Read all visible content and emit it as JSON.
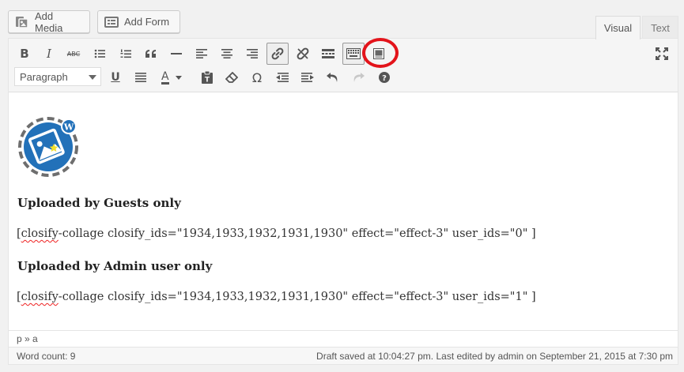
{
  "buttons": {
    "add_media": "Add Media",
    "add_form": "Add Form"
  },
  "tabs": {
    "visual": "Visual",
    "text": "Text"
  },
  "toolbar": {
    "format_select": "Paragraph",
    "row1_icons": [
      "bold-icon",
      "italic-icon",
      "strikethrough-icon",
      "bulleted-list-icon",
      "numbered-list-icon",
      "blockquote-icon",
      "horizontal-line-icon",
      "align-left-icon",
      "align-center-icon",
      "align-right-icon",
      "link-icon",
      "unlink-icon",
      "read-more-icon",
      "toolbar-toggle-icon",
      "collage-shortcode-icon",
      "fullscreen-icon"
    ],
    "row2_icons": [
      "underline-icon",
      "justify-icon",
      "text-color-icon",
      "paste-text-icon",
      "clear-formatting-icon",
      "special-character-icon",
      "outdent-icon",
      "indent-icon",
      "undo-icon",
      "redo-icon",
      "help-icon"
    ],
    "bold_label": "B",
    "italic_label": "I",
    "strike_label": "ABC",
    "underline_label": "U",
    "omega_label": "Ω",
    "color_label": "A",
    "highlight_color": "#e3141b"
  },
  "content": {
    "heading1": "Uploaded by Guests only",
    "shortcode1_prefix": "[",
    "shortcode1_spell": "closify",
    "shortcode1_rest": "-collage closify_ids=\"1934,1933,1932,1931,1930\" effect=\"effect-3\" user_ids=\"0\" ]",
    "heading2": "Uploaded by Admin user only",
    "shortcode2_prefix": "[",
    "shortcode2_spell": "closify",
    "shortcode2_rest": "-collage closify_ids=\"1934,1933,1932,1931,1930\" effect=\"effect-3\" user_ids=\"1\" ]"
  },
  "path": "p » a",
  "status": {
    "word_count": "Word count: 9",
    "draft_saved": "Draft saved at 10:04:27 pm. Last edited by admin on September 21, 2015 at 7:30 pm"
  }
}
